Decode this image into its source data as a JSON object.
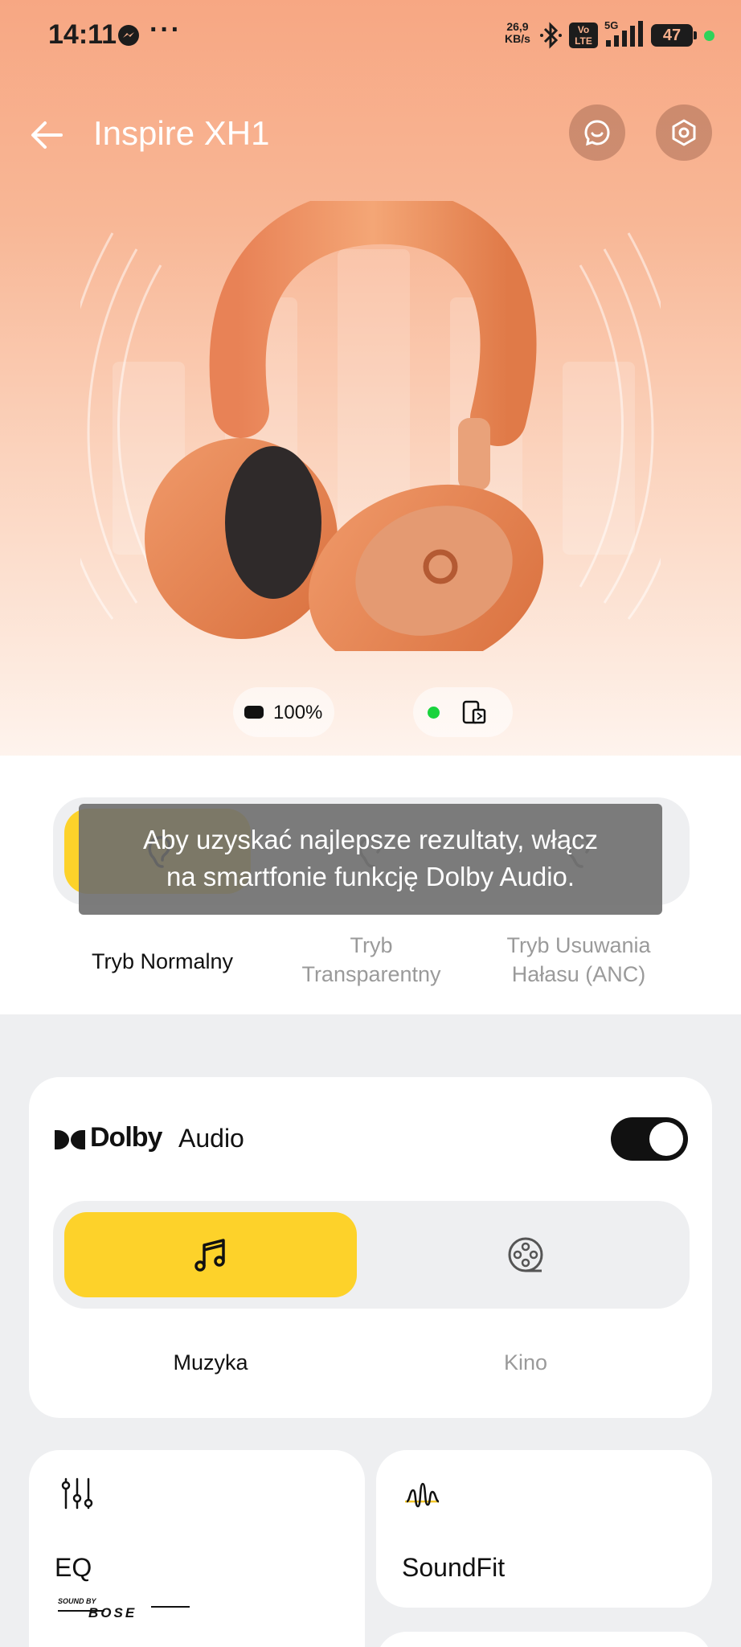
{
  "status_bar": {
    "time": "14:11",
    "dots": "···",
    "net_speed_value": "26,9",
    "net_speed_unit": "KB/s",
    "volte_top": "Vo",
    "volte_bottom": "LTE",
    "network": "5G",
    "battery": "47",
    "icons": [
      "messenger-icon",
      "bluetooth-icon",
      "signal-icon"
    ]
  },
  "header": {
    "title": "Inspire XH1",
    "buttons": [
      "back-icon",
      "support-chat-icon",
      "settings-icon"
    ]
  },
  "device": {
    "battery": "100%",
    "connected": true,
    "accent_connected": "#19d33d"
  },
  "modes": {
    "items": [
      {
        "label": "Tryb Normalny",
        "selected": true
      },
      {
        "label": "Tryb Transparentny",
        "selected": false
      },
      {
        "label": "Tryb Usuwania Hałasu (ANC)",
        "selected": false
      }
    ],
    "label_normal": "Tryb Normalny",
    "label_transparent_1": "Tryb",
    "label_transparent_2": "Transparentny",
    "label_anc_1": "Tryb Usuwania",
    "label_anc_2": "Hałasu (ANC)",
    "accent": "#fdd22a"
  },
  "toast": {
    "line1": "Aby uzyskać najlepsze rezultaty, włącz",
    "line2": "na smartfonie funkcję Dolby Audio."
  },
  "dolby": {
    "brand": "Dolby",
    "title": "Audio",
    "enabled": true,
    "tabs": [
      {
        "label": "Muzyka",
        "selected": true,
        "icon": "music-note-icon"
      },
      {
        "label": "Kino",
        "selected": false,
        "icon": "film-reel-icon"
      }
    ]
  },
  "features": {
    "eq": {
      "label": "EQ",
      "badge_line1": "SOUND BY",
      "badge_line2": "BOSE"
    },
    "soundfit": {
      "label": "SoundFit"
    }
  }
}
